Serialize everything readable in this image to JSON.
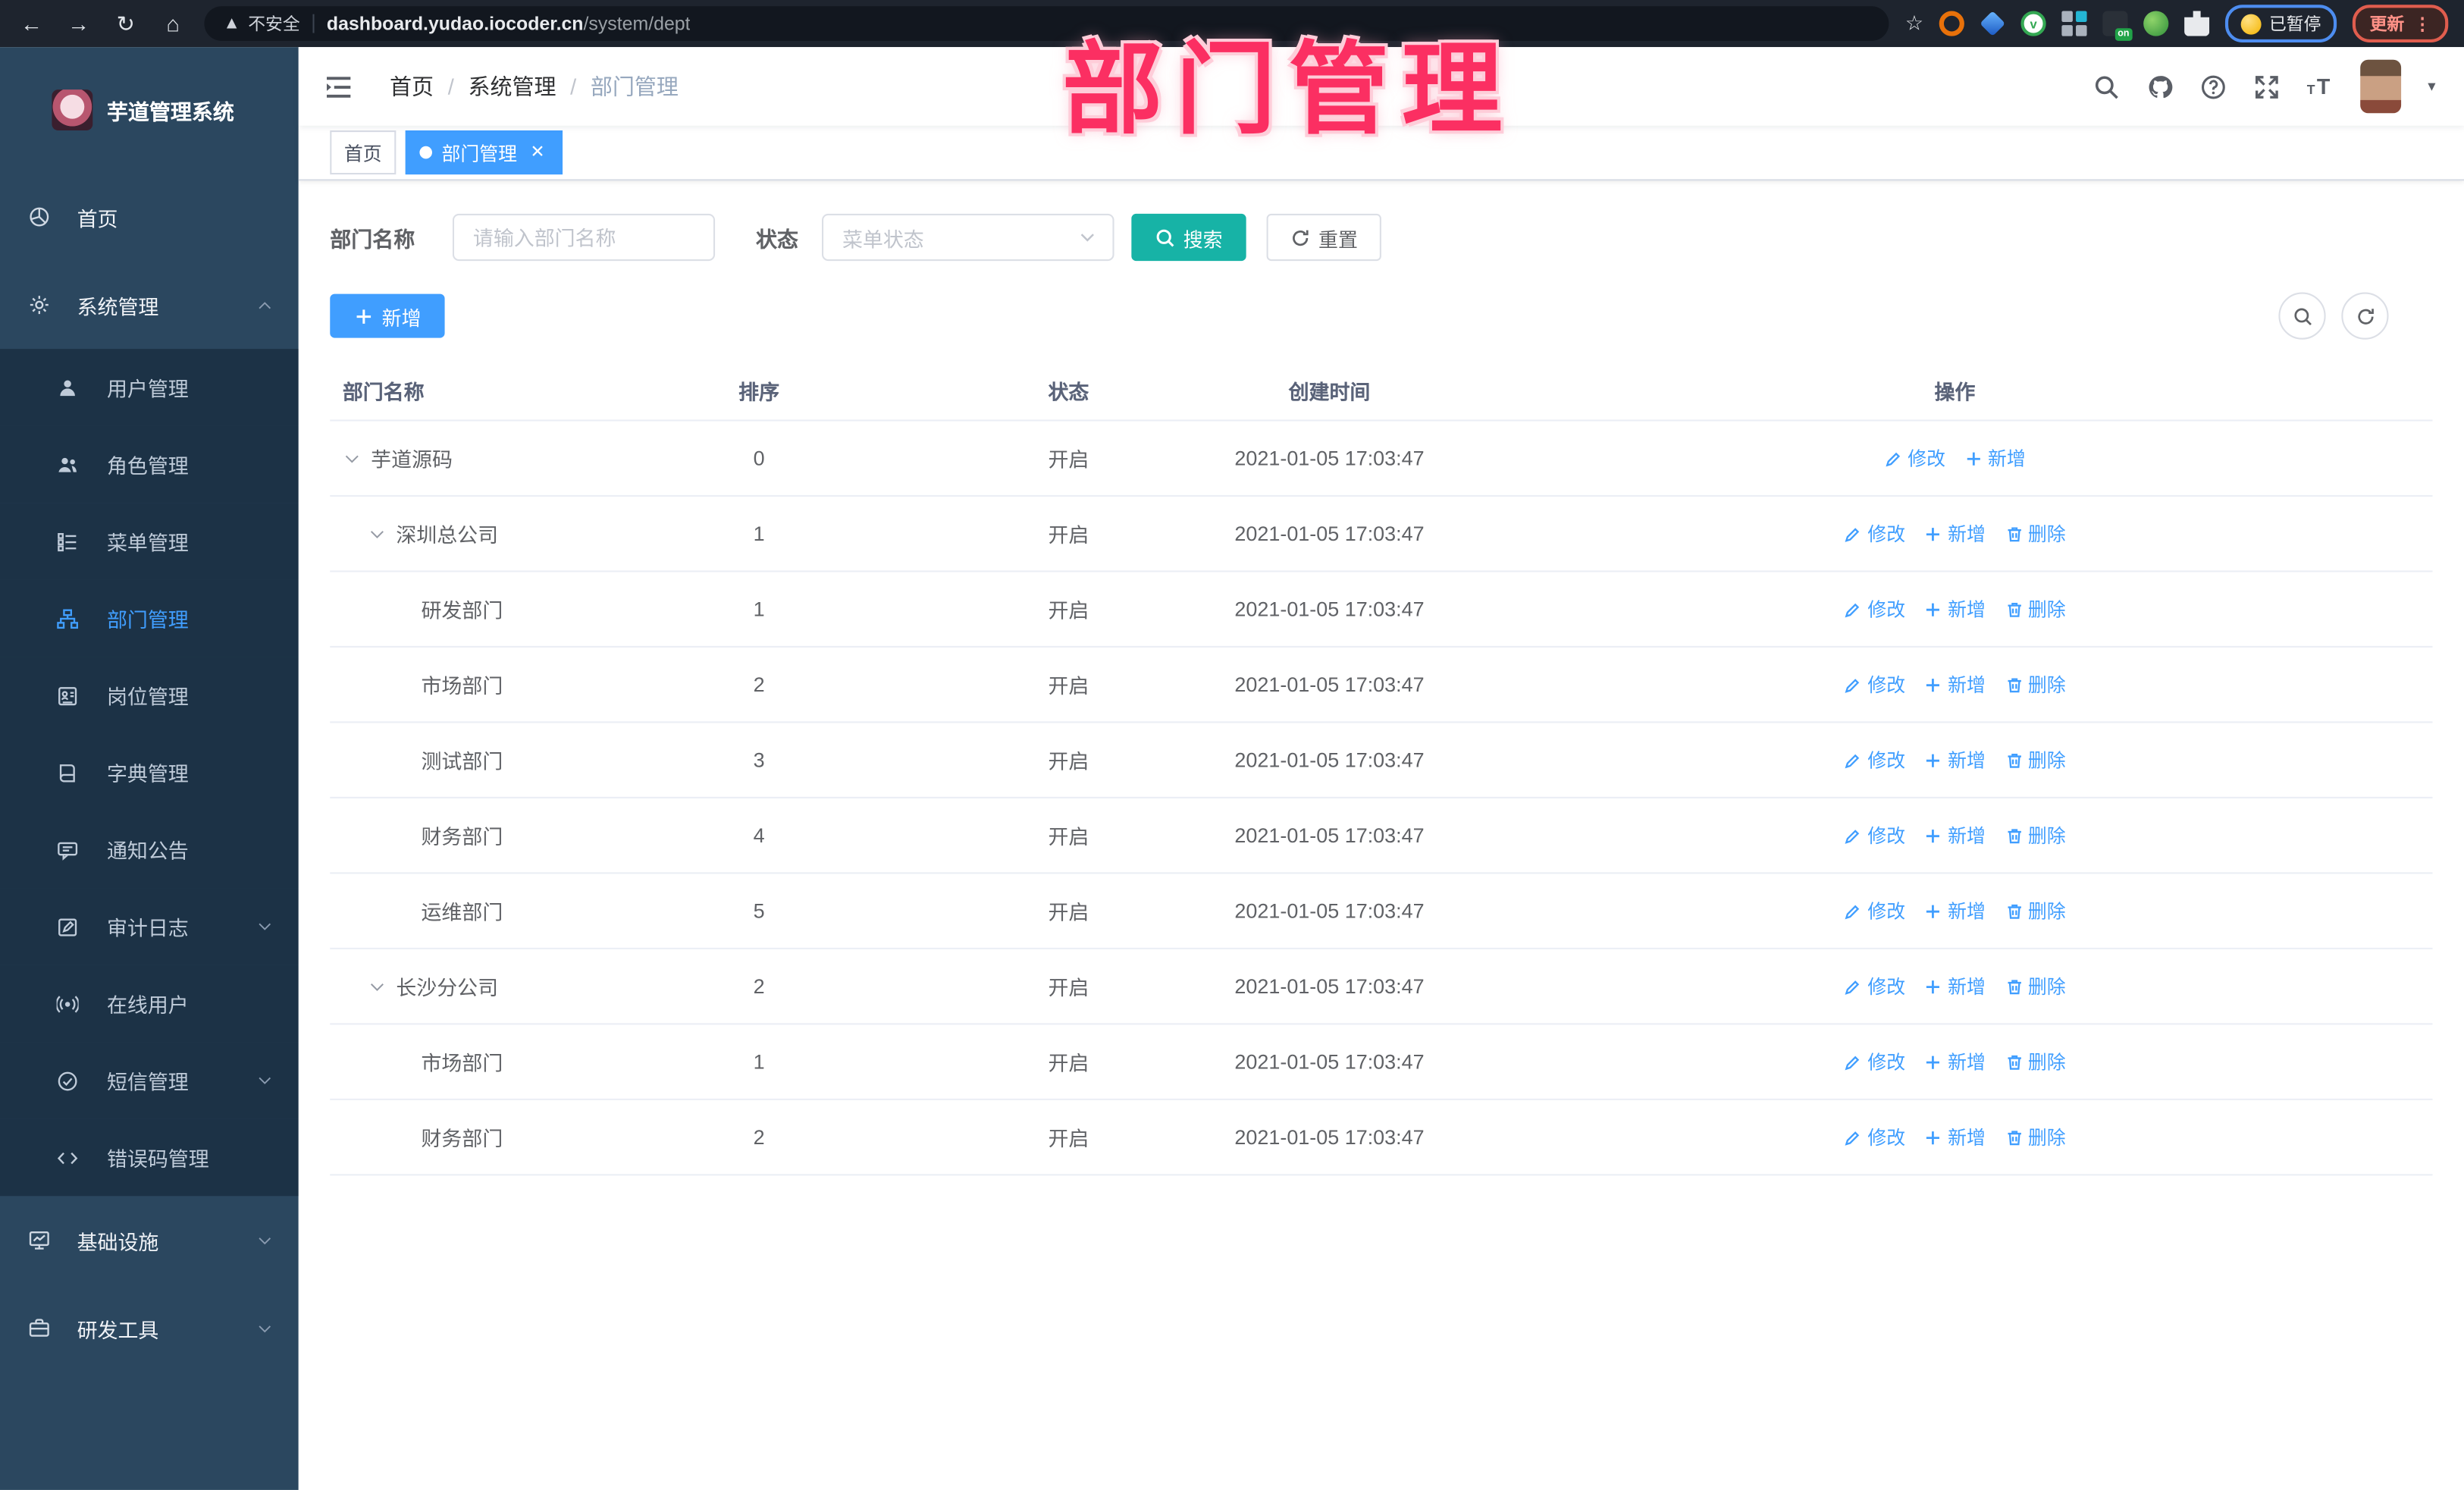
{
  "browser": {
    "security_label": "不安全",
    "url_host": "dashboard.yudao.iocoder.cn",
    "url_path": "/system/dept",
    "profile_chip": "已暂停",
    "update_label": "更新"
  },
  "watermark": "部门管理",
  "sidebar": {
    "title": "芋道管理系统",
    "items": [
      {
        "key": "home",
        "label": "首页",
        "level": 1
      },
      {
        "key": "system-mgmt",
        "label": "系统管理",
        "level": 1,
        "chevron": "up"
      },
      {
        "key": "user-mgmt",
        "label": "用户管理",
        "level": 2
      },
      {
        "key": "role-mgmt",
        "label": "角色管理",
        "level": 2
      },
      {
        "key": "menu-mgmt",
        "label": "菜单管理",
        "level": 2
      },
      {
        "key": "dept-mgmt",
        "label": "部门管理",
        "level": 2,
        "active": true
      },
      {
        "key": "post-mgmt",
        "label": "岗位管理",
        "level": 2
      },
      {
        "key": "dict-mgmt",
        "label": "字典管理",
        "level": 2
      },
      {
        "key": "notice",
        "label": "通知公告",
        "level": 2
      },
      {
        "key": "audit-log",
        "label": "审计日志",
        "level": 2,
        "chevron": "down"
      },
      {
        "key": "online-users",
        "label": "在线用户",
        "level": 2
      },
      {
        "key": "sms-mgmt",
        "label": "短信管理",
        "level": 2,
        "chevron": "down"
      },
      {
        "key": "error-code-mgmt",
        "label": "错误码管理",
        "level": 2
      },
      {
        "key": "infrastructure",
        "label": "基础设施",
        "level": 1,
        "chevron": "down"
      },
      {
        "key": "dev-tools",
        "label": "研发工具",
        "level": 1,
        "chevron": "down"
      }
    ]
  },
  "navbar": {
    "breadcrumb": [
      "首页",
      "系统管理",
      "部门管理"
    ]
  },
  "tabs": [
    {
      "label": "首页",
      "active": false
    },
    {
      "label": "部门管理",
      "active": true,
      "closable": true
    }
  ],
  "filters": {
    "name_label": "部门名称",
    "name_placeholder": "请输入部门名称",
    "status_label": "状态",
    "status_placeholder": "菜单状态",
    "search_label": "搜索",
    "reset_label": "重置"
  },
  "toolbar": {
    "add_label": "新增"
  },
  "table": {
    "headers": [
      "部门名称",
      "排序",
      "状态",
      "创建时间",
      "操作"
    ],
    "action_labels": {
      "edit": "修改",
      "add": "新增",
      "delete": "删除"
    },
    "rows": [
      {
        "name": "芋道源码",
        "level": 0,
        "expandable": true,
        "sort": "0",
        "status": "开启",
        "created": "2021-01-05 17:03:47",
        "actions": [
          "edit",
          "add"
        ]
      },
      {
        "name": "深圳总公司",
        "level": 1,
        "expandable": true,
        "sort": "1",
        "status": "开启",
        "created": "2021-01-05 17:03:47",
        "actions": [
          "edit",
          "add",
          "delete"
        ]
      },
      {
        "name": "研发部门",
        "level": 2,
        "expandable": false,
        "sort": "1",
        "status": "开启",
        "created": "2021-01-05 17:03:47",
        "actions": [
          "edit",
          "add",
          "delete"
        ]
      },
      {
        "name": "市场部门",
        "level": 2,
        "expandable": false,
        "sort": "2",
        "status": "开启",
        "created": "2021-01-05 17:03:47",
        "actions": [
          "edit",
          "add",
          "delete"
        ]
      },
      {
        "name": "测试部门",
        "level": 2,
        "expandable": false,
        "sort": "3",
        "status": "开启",
        "created": "2021-01-05 17:03:47",
        "actions": [
          "edit",
          "add",
          "delete"
        ]
      },
      {
        "name": "财务部门",
        "level": 2,
        "expandable": false,
        "sort": "4",
        "status": "开启",
        "created": "2021-01-05 17:03:47",
        "actions": [
          "edit",
          "add",
          "delete"
        ]
      },
      {
        "name": "运维部门",
        "level": 2,
        "expandable": false,
        "sort": "5",
        "status": "开启",
        "created": "2021-01-05 17:03:47",
        "actions": [
          "edit",
          "add",
          "delete"
        ]
      },
      {
        "name": "长沙分公司",
        "level": 1,
        "expandable": true,
        "sort": "2",
        "status": "开启",
        "created": "2021-01-05 17:03:47",
        "actions": [
          "edit",
          "add",
          "delete"
        ]
      },
      {
        "name": "市场部门",
        "level": 2,
        "expandable": false,
        "sort": "1",
        "status": "开启",
        "created": "2021-01-05 17:03:47",
        "actions": [
          "edit",
          "add",
          "delete"
        ]
      },
      {
        "name": "财务部门",
        "level": 2,
        "expandable": false,
        "sort": "2",
        "status": "开启",
        "created": "2021-01-05 17:03:47",
        "actions": [
          "edit",
          "add",
          "delete"
        ]
      }
    ]
  },
  "colors": {
    "accent": "#409EFF",
    "search_button": "#17b3a6",
    "watermark_pink": "#fb2f62",
    "sidebar_bg": "#2b475f",
    "submenu_bg": "#1c3246"
  }
}
